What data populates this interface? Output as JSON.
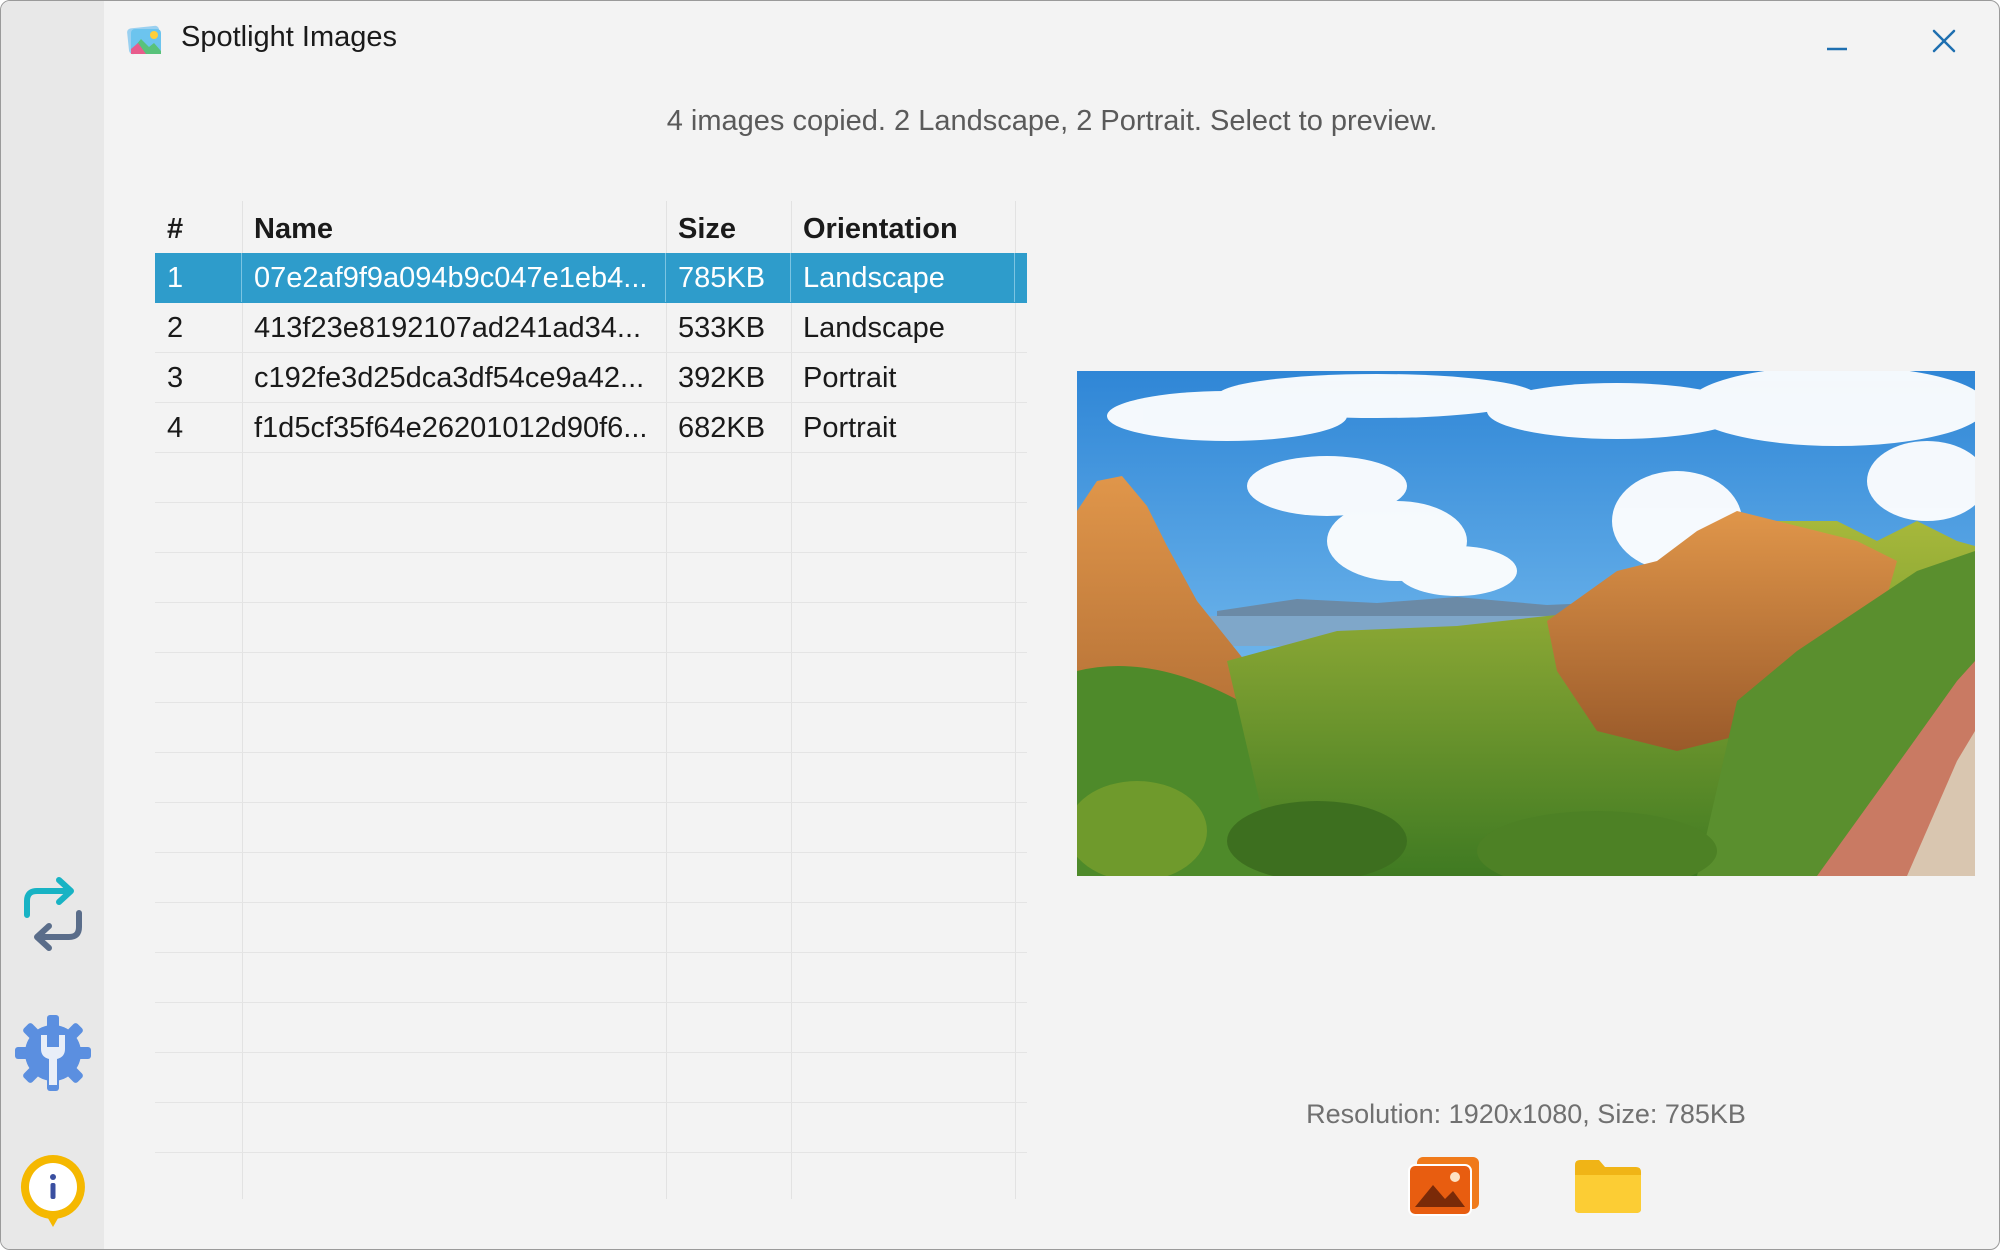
{
  "window": {
    "title": "Spotlight Images"
  },
  "status_text": "4 images copied. 2 Landscape, 2 Portrait. Select to preview.",
  "table": {
    "headers": [
      "#",
      "Name",
      "Size",
      "Orientation"
    ],
    "rows": [
      {
        "num": "1",
        "name": "07e2af9f9a094b9c047e1eb4...",
        "size": "785KB",
        "orientation": "Landscape",
        "selected": true
      },
      {
        "num": "2",
        "name": "413f23e8192107ad241ad34...",
        "size": "533KB",
        "orientation": "Landscape",
        "selected": false
      },
      {
        "num": "3",
        "name": "c192fe3d25dca3df54ce9a42...",
        "size": "392KB",
        "orientation": "Portrait",
        "selected": false
      },
      {
        "num": "4",
        "name": "f1d5cf35f64e26201012d90f6...",
        "size": "682KB",
        "orientation": "Portrait",
        "selected": false
      }
    ]
  },
  "preview": {
    "info": "Resolution: 1920x1080, Size: 785KB"
  },
  "sidebar": {
    "icons": [
      "swap-arrows-icon",
      "settings-wrench-icon",
      "info-icon"
    ]
  },
  "actions": {
    "icons": [
      "open-image-icon",
      "open-folder-icon"
    ]
  },
  "colors": {
    "selection": "#2e9ccb",
    "accent": "#1e6fb0",
    "window_bg": "#f3f3f3",
    "sidebar_bg": "#e8e8e8"
  }
}
